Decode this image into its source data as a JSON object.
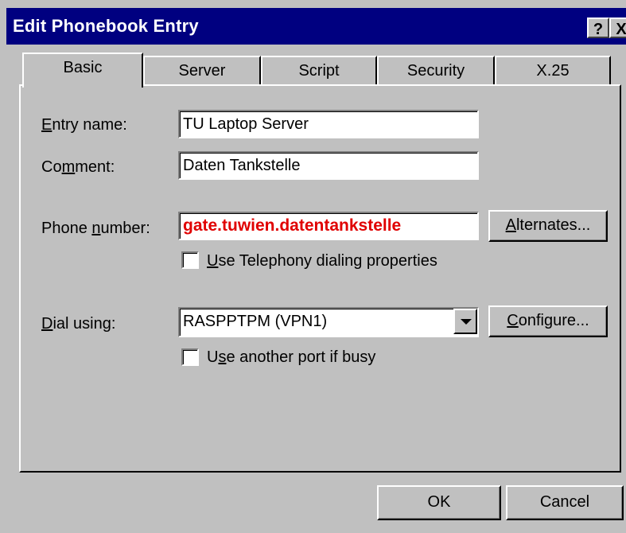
{
  "window": {
    "title": "Edit Phonebook Entry",
    "help_label": "?",
    "close_label": "X"
  },
  "tabs": [
    {
      "label": "Basic",
      "active": true
    },
    {
      "label": "Server",
      "active": false
    },
    {
      "label": "Script",
      "active": false
    },
    {
      "label": "Security",
      "active": false
    },
    {
      "label": "X.25",
      "active": false
    }
  ],
  "basic": {
    "entry_name": {
      "label_pre": "",
      "label_ul": "E",
      "label_post": "ntry name:",
      "value": "TU Laptop Server"
    },
    "comment": {
      "label_pre": "Co",
      "label_ul": "m",
      "label_post": "ment:",
      "value": "Daten Tankstelle"
    },
    "phone_number": {
      "label_pre": "Phone ",
      "label_ul": "n",
      "label_post": "umber:",
      "value": "gate.tuwien.datentankstelle"
    },
    "alternates_button": {
      "label_pre": "",
      "label_ul": "A",
      "label_post": "lternates..."
    },
    "use_telephony": {
      "label_pre": "",
      "label_ul": "U",
      "label_post": "se Telephony dialing properties",
      "checked": false
    },
    "dial_using": {
      "label_pre": "",
      "label_ul": "D",
      "label_post": "ial using:",
      "value": "RASPPTPM (VPN1)"
    },
    "configure_button": {
      "label_pre": "",
      "label_ul": "C",
      "label_post": "onfigure..."
    },
    "use_another_port": {
      "label_pre": "U",
      "label_ul": "s",
      "label_post": "e another port if busy",
      "checked": false
    }
  },
  "footer": {
    "ok_label": "OK",
    "cancel_label": "Cancel"
  },
  "colors": {
    "title_bar": "#000080",
    "face": "#c0c0c0",
    "phone_text": "#e00000"
  }
}
